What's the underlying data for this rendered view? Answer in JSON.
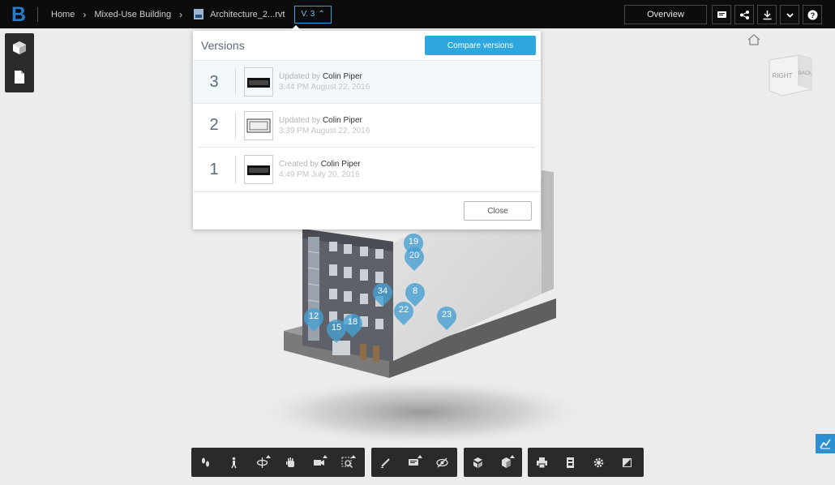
{
  "breadcrumb": {
    "items": [
      "Home",
      "Mixed-Use Building",
      "Architecture_2...rvt"
    ],
    "version_label": "V. 3"
  },
  "topbar": {
    "overview_label": "Overview",
    "icons": [
      "comment-icon",
      "share-icon",
      "download-icon",
      "chevron-down-icon",
      "help-icon"
    ]
  },
  "versions": {
    "title": "Versions",
    "compare_label": "Compare versions",
    "close_label": "Close",
    "rows": [
      {
        "number": "3",
        "action": "Updated by",
        "user": "Colin Piper",
        "date": "3:44 PM August 22, 2016"
      },
      {
        "number": "2",
        "action": "Updated by",
        "user": "Colin Piper",
        "date": "3:39 PM August 22, 2016"
      },
      {
        "number": "1",
        "action": "Created by",
        "user": "Colin Piper",
        "date": "4:49 PM July 20, 2016"
      }
    ]
  },
  "viewcube": {
    "face_right": "RIGHT",
    "face_back": "BACK"
  },
  "pins": [
    "19",
    "20",
    "34",
    "8",
    "22",
    "23",
    "12",
    "15",
    "18"
  ],
  "toolbar": {
    "group1": [
      "footprints-icon",
      "walk-icon",
      "orbit-icon",
      "pan-icon",
      "camera-icon",
      "zoom-window-icon"
    ],
    "group2": [
      "markup-icon",
      "comment-icon",
      "visibility-icon"
    ],
    "group3": [
      "explode-icon",
      "section-icon"
    ],
    "group4": [
      "print-icon",
      "properties-icon",
      "settings-icon",
      "fullscreen-icon"
    ]
  },
  "colors": {
    "accent": "#2ea7df",
    "topbar": "#0c0c0c",
    "pin": "#46a0d2"
  }
}
